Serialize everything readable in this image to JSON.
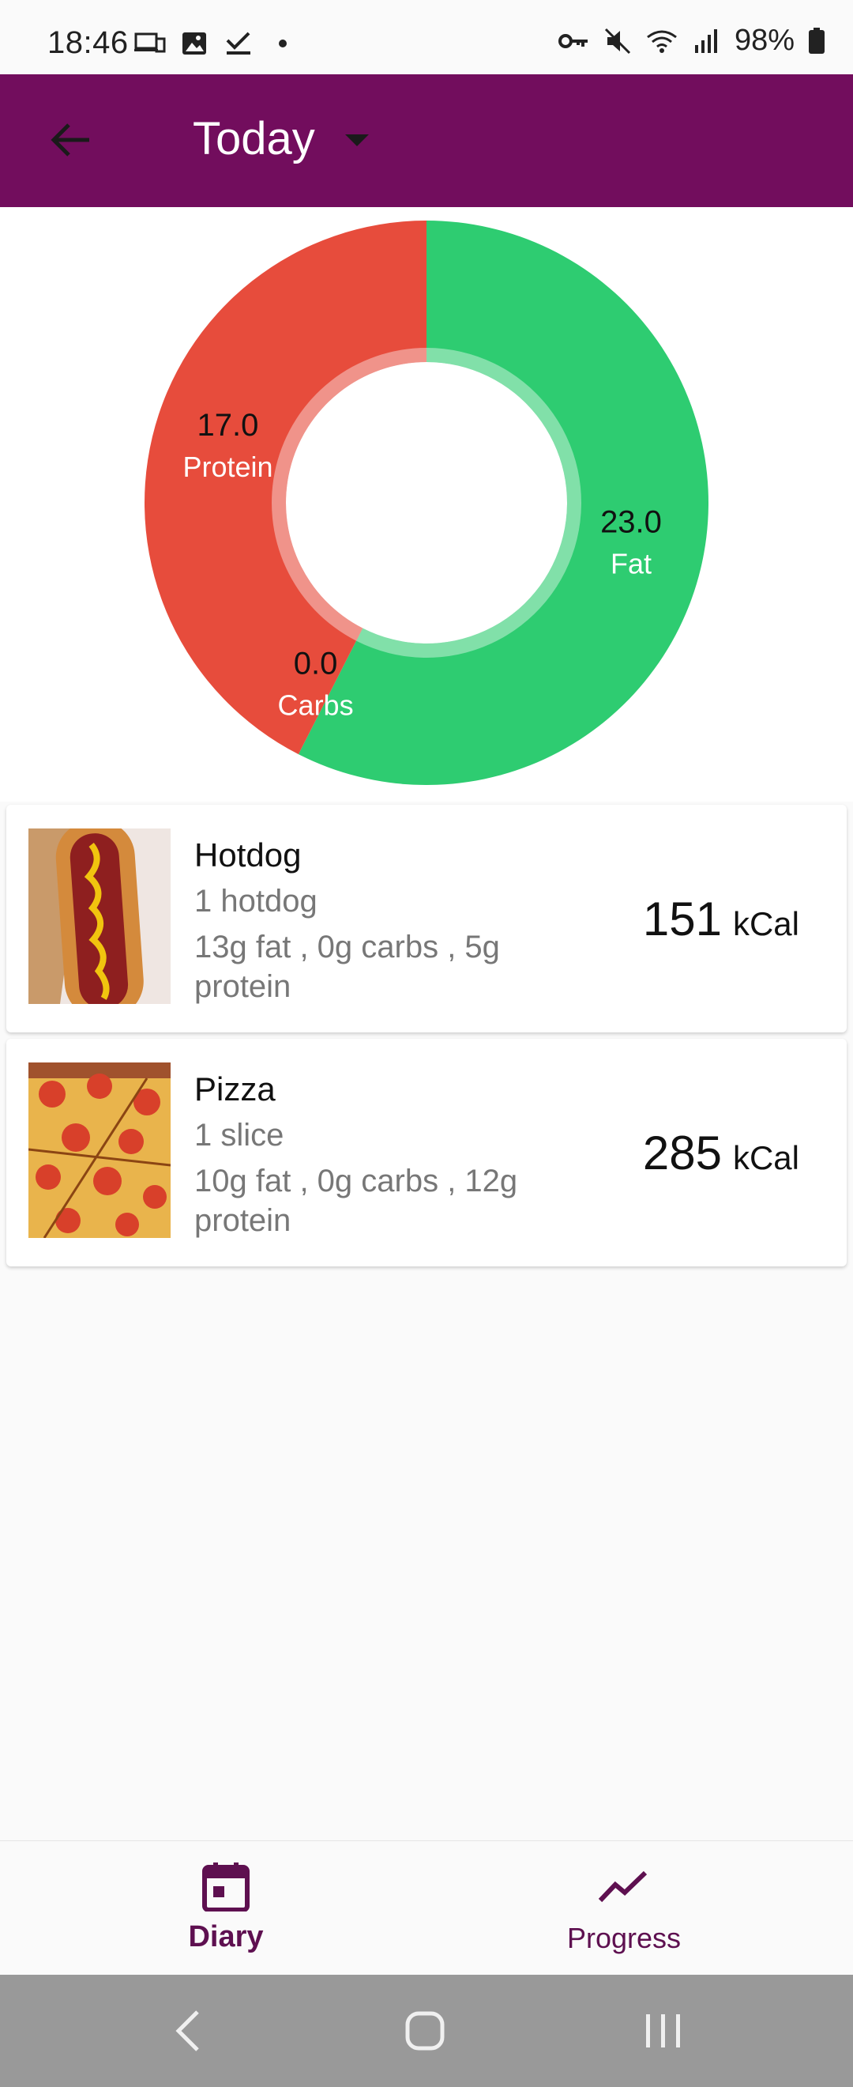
{
  "status_bar": {
    "time": "18:46",
    "battery": "98%",
    "left_icons": [
      "devices-icon",
      "image-icon",
      "check-icon",
      "dot-icon"
    ],
    "right_icons": [
      "key-icon",
      "mute-icon",
      "wifi-icon",
      "signal-icon",
      "battery-icon"
    ]
  },
  "app_bar": {
    "title": "Today",
    "back_icon": "arrow-back-icon",
    "dropdown_icon": "dropdown-arrow-icon",
    "color": "#720d5d"
  },
  "chart_data": {
    "type": "pie",
    "style": "donut",
    "slices": [
      {
        "label": "Fat",
        "value_label": "23.0",
        "value": 23.0,
        "color": "#2ecc71"
      },
      {
        "label": "Carbs",
        "value_label": "0.0",
        "value": 0.0,
        "color": "#2ecc71"
      },
      {
        "label": "Protein",
        "value_label": "17.0",
        "value": 17.0,
        "color": "#e74c3c"
      }
    ]
  },
  "foods": [
    {
      "name": "Hotdog",
      "serving": "1 hotdog",
      "macros": "13g fat , 0g carbs , 5g protein",
      "kcal": "151",
      "kcal_unit": "kCal",
      "image": "hotdog-photo"
    },
    {
      "name": "Pizza",
      "serving": "1 slice",
      "macros": "10g fat , 0g carbs , 12g protein",
      "kcal": "285",
      "kcal_unit": "kCal",
      "image": "pizza-photo"
    }
  ],
  "bottom_nav": {
    "items": [
      {
        "label": "Diary",
        "icon": "calendar-icon",
        "active": true
      },
      {
        "label": "Progress",
        "icon": "trending-up-icon",
        "active": false
      }
    ]
  },
  "system_nav": {
    "icons": [
      "back-nav-icon",
      "home-nav-icon",
      "recents-nav-icon"
    ]
  }
}
